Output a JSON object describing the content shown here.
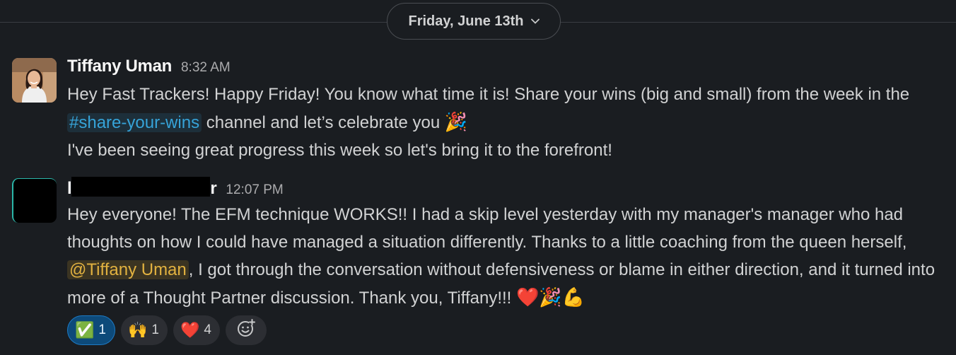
{
  "date_divider": {
    "label": "Friday, June 13th",
    "chevron": "chevron-down-icon"
  },
  "messages": [
    {
      "author": "Tiffany Uman",
      "time": "8:32 AM",
      "avatar": "photo",
      "line1_a": "Hey Fast Trackers! Happy Friday! You know what time it is! Share your wins (big and small) from the week in the ",
      "channel": "#share-your-wins",
      "line1_b": " channel and let’s celebrate you ",
      "emoji1": "🎉",
      "line2": "I've been seeing great progress this week so let's bring it to the forefront!"
    },
    {
      "author_prefix": "l",
      "author_suffix": "r",
      "time": "12:07 PM",
      "avatar": "redacted",
      "text_a": "Hey everyone! The EFM technique WORKS!! I had a skip level yesterday with my manager's manager who had thoughts on how I could have managed a situation differently. Thanks to a little coaching from the queen herself, ",
      "mention": "@Tiffany Uman",
      "text_b": ", I got through the conversation without defensiveness or blame in either direction, and it turned into more of a Thought Partner discussion. Thank you, Tiffany!!! ",
      "emojis": "❤️🎉💪",
      "reactions": [
        {
          "emoji": "✅",
          "count": "1",
          "active": true
        },
        {
          "emoji": "🙌",
          "count": "1",
          "active": false
        },
        {
          "emoji": "❤️",
          "count": "4",
          "active": false
        }
      ],
      "add_reaction_icon": "add-reaction-icon"
    }
  ]
}
